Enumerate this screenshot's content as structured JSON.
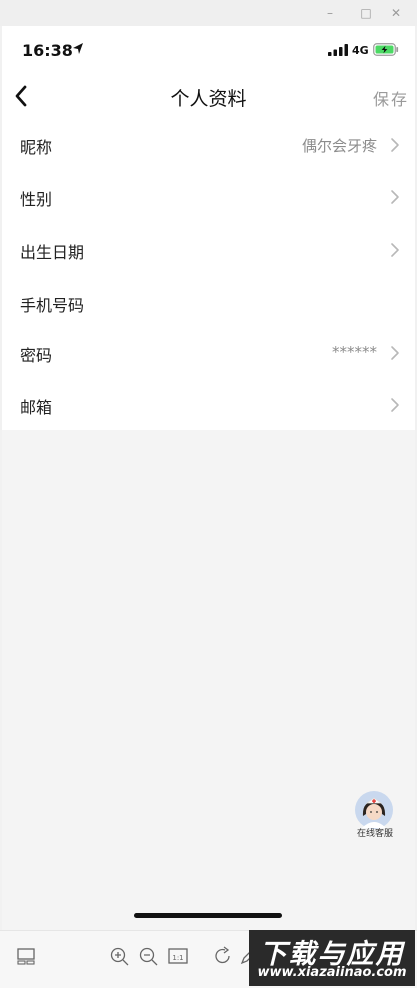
{
  "window": {
    "minimize_glyph": "–",
    "maximize_glyph": "□",
    "close_glyph": "✕"
  },
  "status_bar": {
    "time": "16:38",
    "network": "4G",
    "icons": [
      "location-arrow-icon",
      "signal-icon",
      "battery-charging-icon"
    ]
  },
  "nav": {
    "title": "个人资料",
    "save_label": "保存",
    "back_icon": "chevron-left-icon"
  },
  "profile_rows": [
    {
      "label": "昵称",
      "value": "偶尔会牙疼"
    },
    {
      "label": "性别",
      "value": ""
    },
    {
      "label": "出生日期",
      "value": ""
    },
    {
      "label": "手机号码",
      "value": ""
    },
    {
      "label": "密码",
      "value": "******"
    },
    {
      "label": "邮箱",
      "value": ""
    }
  ],
  "service": {
    "label": "在线客服",
    "icon": "nurse-avatar-icon"
  },
  "toolbar": {
    "icons": [
      "thumbnail-icon",
      "zoom-in-icon",
      "zoom-out-icon",
      "actual-size-icon",
      "rotate-icon",
      "edit-icon"
    ],
    "actual_size_label": "1:1"
  },
  "watermark": {
    "main": "下载与应用",
    "sub": "www.xiazaiinao.com"
  },
  "colors": {
    "background": "#f4f4f4",
    "card": "#ffffff",
    "secondary_text": "#8c8c8c",
    "battery_fill": "#4cd964"
  }
}
